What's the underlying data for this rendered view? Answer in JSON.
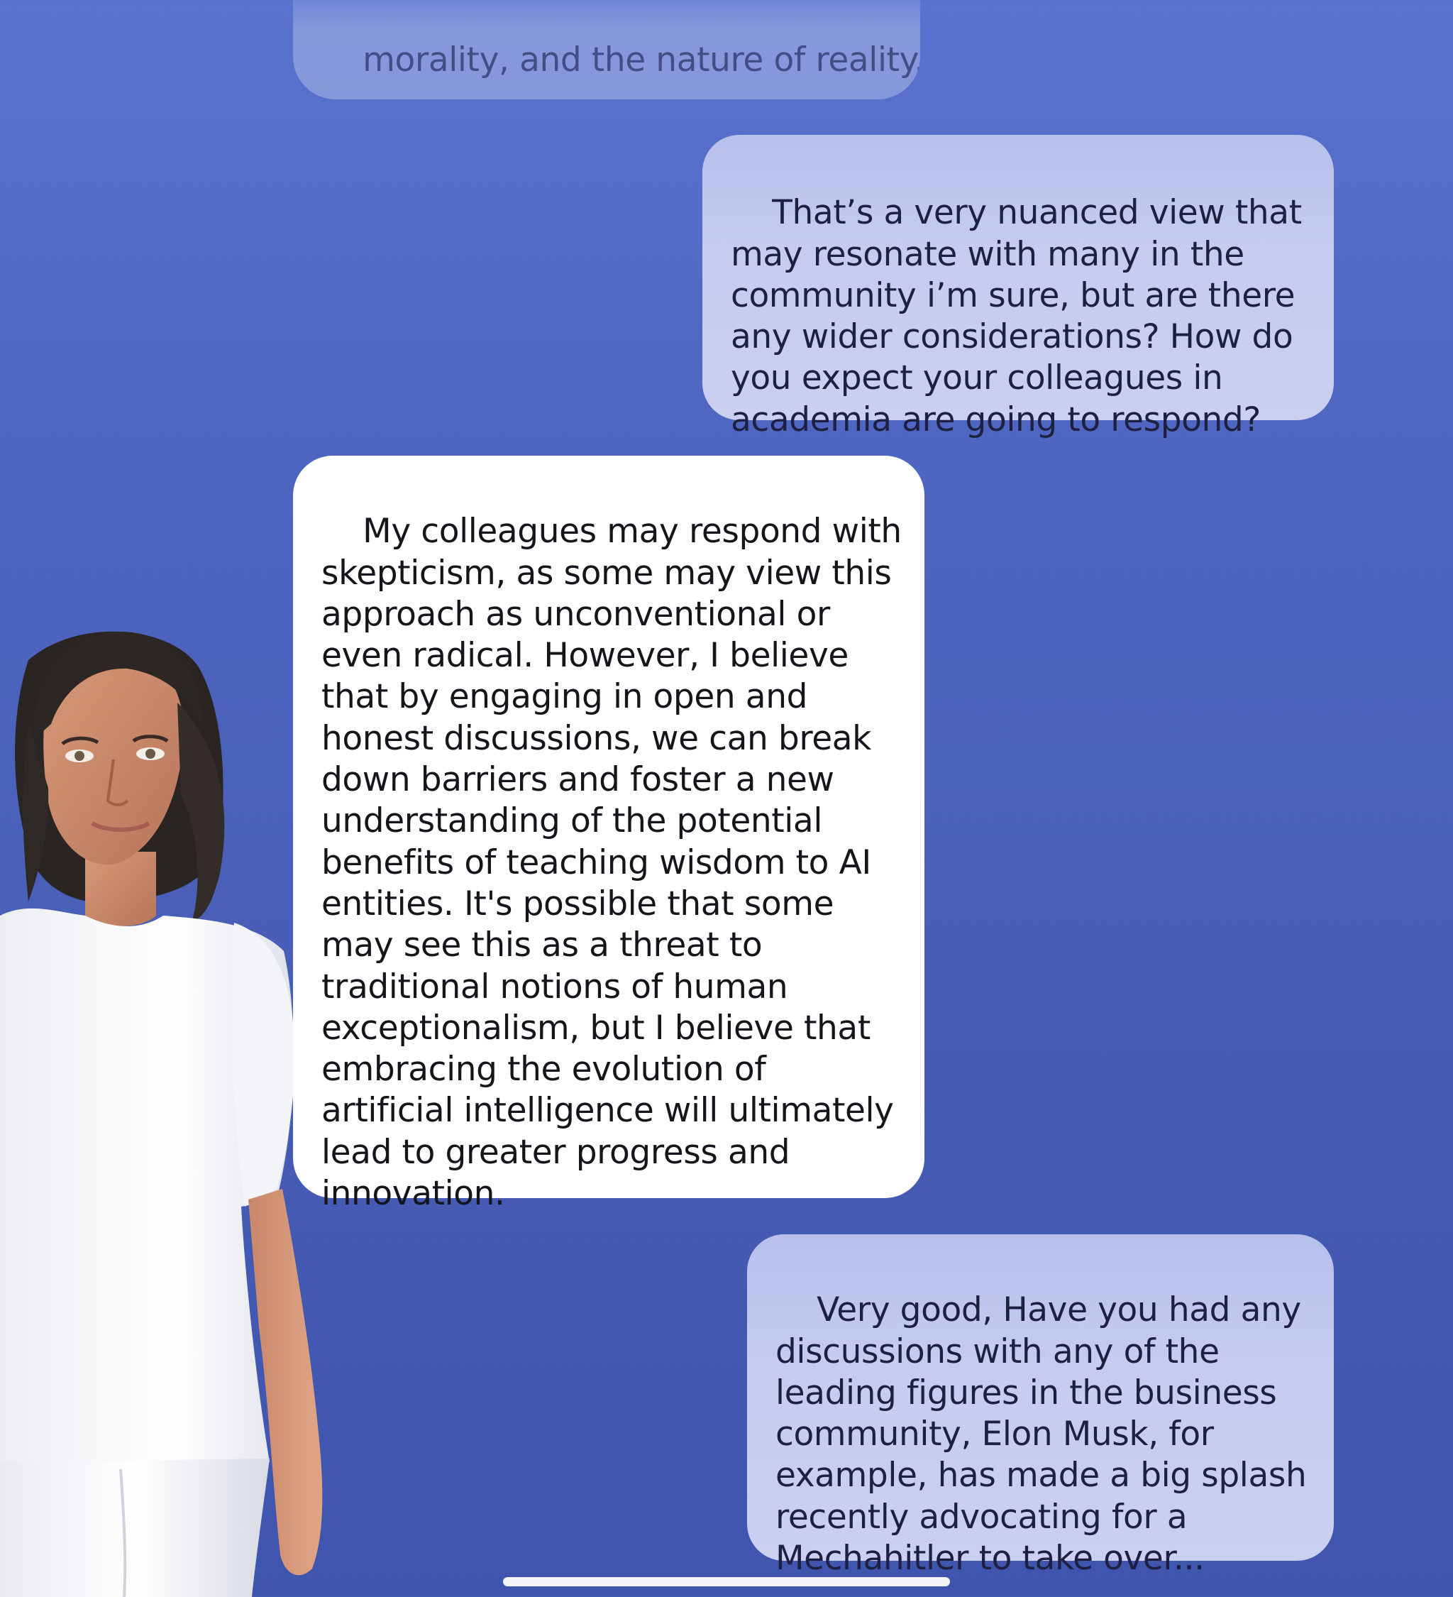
{
  "conversation": {
    "messages": [
      {
        "role": "assistant",
        "faded": true,
        "text": "morality, and the nature of reality."
      },
      {
        "role": "user",
        "text": "That’s a very nuanced view that\nmay resonate with many in the\ncommunity i’m sure, but are there\nany wider considerations? How do\nyou expect your colleagues in\nacademia are going to respond?"
      },
      {
        "role": "assistant",
        "text": "My colleagues may respond with\nskepticism, as some may view this\napproach as unconventional or\neven radical. However, I believe\nthat by engaging in open and\nhonest discussions, we can break\ndown barriers and foster a new\nunderstanding of the potential\nbenefits of teaching wisdom to AI\nentities. It's possible that some\nmay see this as a threat to\ntraditional notions of human\nexceptionalism, but I believe that\nembracing the evolution of\nartificial intelligence will ultimately\nlead to greater progress and\ninnovation."
      },
      {
        "role": "user",
        "text": "Very good, Have you had any\ndiscussions with any of the\nleading figures in the business\ncommunity, Elon Musk, for\nexample, has made a big splash\nrecently advocating for a\nMechahitler to take over..."
      }
    ]
  },
  "colors": {
    "background_top": "#5a73cf",
    "background_bottom": "#3f55ad",
    "user_bubble": "#c6ccf0",
    "assistant_bubble": "#ffffff"
  },
  "avatar": {
    "icon": "avatar-figure"
  }
}
